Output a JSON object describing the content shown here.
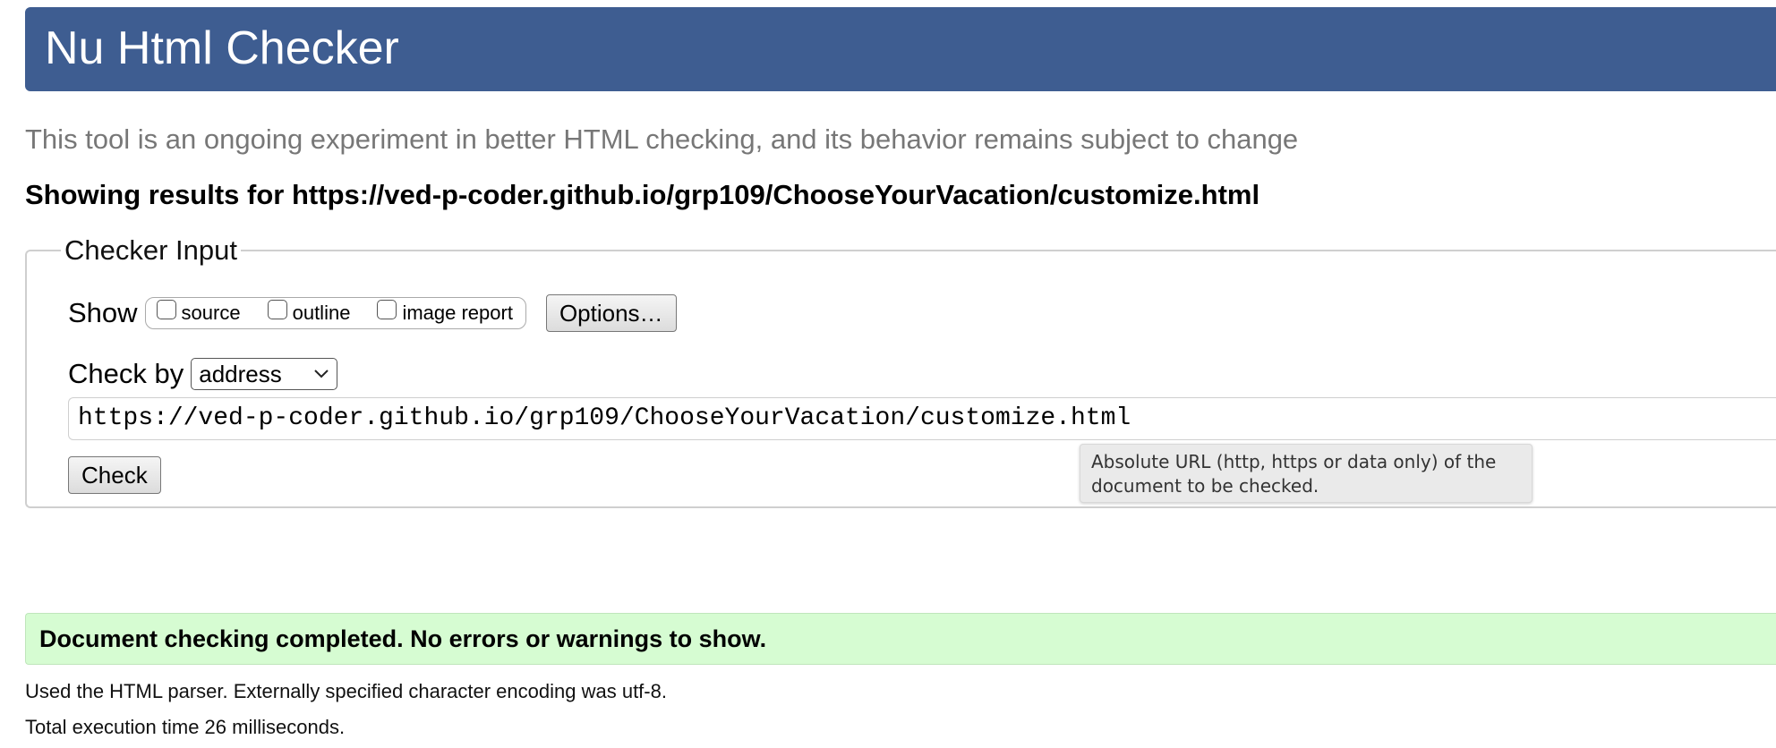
{
  "header": {
    "title": "Nu Html Checker",
    "background_color": "#3e5d91"
  },
  "subtitle": "This tool is an ongoing experiment in better HTML checking, and its behavior remains subject to change",
  "results": {
    "prefix": "Showing results for",
    "url": "https://ved-p-coder.github.io/grp109/ChooseYourVacation/customize.html"
  },
  "checker_input": {
    "legend": "Checker Input",
    "show_label": "Show",
    "show_options": [
      {
        "label": "source",
        "checked": false
      },
      {
        "label": "outline",
        "checked": false
      },
      {
        "label": "image report",
        "checked": false
      }
    ],
    "options_button": "Options…",
    "check_by_label": "Check by",
    "check_by_selected": "address",
    "url_value": "https://ved-p-coder.github.io/grp109/ChooseYourVacation/customize.html",
    "check_button": "Check",
    "tooltip": {
      "line1": "Absolute URL (http, https or data only) of the",
      "line2": "document to be checked."
    }
  },
  "status": {
    "message": "Document checking completed. No errors or warnings to show.",
    "background_color": "#d6fcd2"
  },
  "info": {
    "parser": "Used the HTML parser. Externally specified character encoding was utf-8.",
    "execution_time": "Total execution time 26 milliseconds."
  },
  "icons": {
    "select_arrow": "chevron-down-icon"
  }
}
